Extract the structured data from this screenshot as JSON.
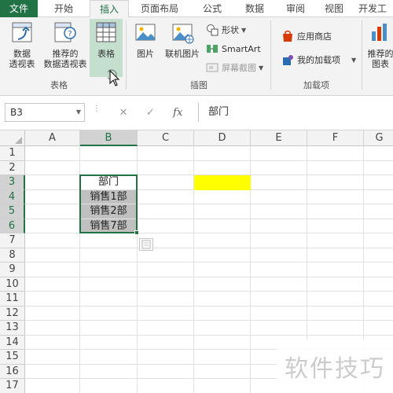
{
  "tabs": {
    "file": "文件",
    "home": "开始",
    "insert": "插入",
    "page_layout": "页面布局",
    "formulas": "公式",
    "data": "数据",
    "review": "审阅",
    "view": "视图",
    "developer": "开发工"
  },
  "ribbon": {
    "tables_group": {
      "label": "表格",
      "pivot_table": "数据\n透视表",
      "recommended_pivot": "推荐的\n数据透视表",
      "table": "表格"
    },
    "illustrations_group": {
      "label": "插图",
      "pictures": "图片",
      "online_pictures": "联机图片",
      "shapes": "形状",
      "smartart": "SmartArt",
      "screenshot": "屏幕截图"
    },
    "addins_group": {
      "label": "加载项",
      "store": "应用商店",
      "my_addins": "我的加载项"
    },
    "charts_partial": {
      "recommended_charts": "推荐的\n图表"
    },
    "icons": {
      "pivot_table": "pivot-table-icon",
      "recommended_pivot": "recommended-pivot-icon",
      "table": "table-icon",
      "pictures": "picture-icon",
      "online_pictures": "online-picture-icon",
      "shapes": "shapes-icon",
      "smartart": "smartart-icon",
      "screenshot": "screenshot-icon",
      "store": "store-icon",
      "my_addins": "addins-icon"
    }
  },
  "formula_bar": {
    "name_box": "B3",
    "cancel_icon": "✕",
    "enter_icon": "✓",
    "fx_icon": "fx",
    "content": "部门"
  },
  "grid": {
    "columns": [
      "A",
      "B",
      "C",
      "D",
      "E",
      "F",
      "G"
    ],
    "rows": [
      "1",
      "2",
      "3",
      "4",
      "5",
      "6",
      "7",
      "8",
      "9",
      "10",
      "11",
      "12",
      "13",
      "14",
      "15",
      "16",
      "17"
    ],
    "cells": {
      "B3": "部门",
      "B4": "销售1部",
      "B5": "销售2部",
      "B6": "销售7部"
    },
    "selected_range": "B3:B6",
    "highlight_cell": "D3"
  },
  "colors": {
    "accent": "#217346",
    "selection_gray": "#c0c0c0",
    "highlight_yellow": "#ffff00"
  },
  "watermark": "软件技巧"
}
